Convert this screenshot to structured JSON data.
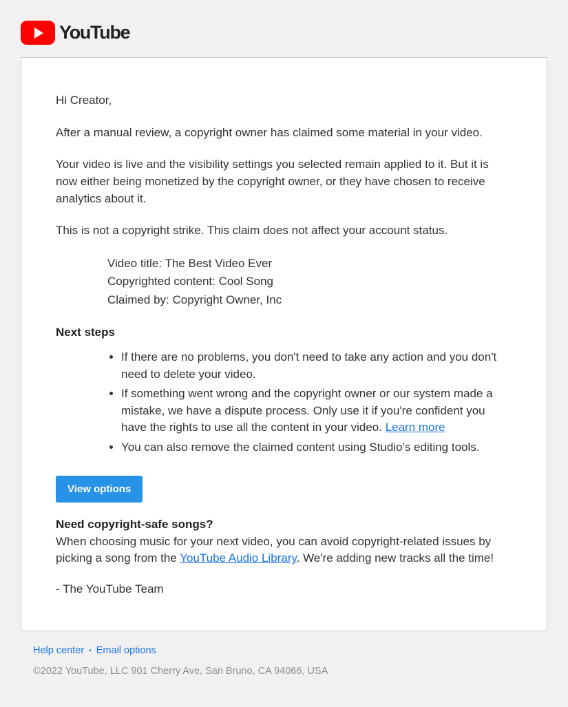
{
  "brand": {
    "wordmark": "YouTube"
  },
  "email": {
    "greeting": "Hi Creator,",
    "p1": "After a manual review, a copyright owner has claimed some material in your video.",
    "p2": "Your video is live and the visibility settings you selected remain applied to it. But it is now either being monetized by the copyright owner, or they have chosen to receive analytics about it.",
    "p3": "This is not a copyright strike. This claim does not affect your account status.",
    "meta": {
      "video_title_label": "Video title: ",
      "video_title_value": "The Best Video Ever",
      "copyrighted_label": "Copyrighted content: ",
      "copyrighted_value": "Cool Song",
      "claimed_by_label": "Claimed by: ",
      "claimed_by_value": "Copyright Owner, Inc"
    },
    "next_steps_heading": "Next steps",
    "next_steps": {
      "0": "If there are no problems, you don't need to take any action and you don't need to delete your video.",
      "1a": "If something went wrong and the copyright owner or our system made a mistake, we have a dispute process. Only use it if you're confident you have the rights to use all the content in your video. ",
      "1_link": "Learn more",
      "2": "You can also remove the claimed content using Studio's editing tools."
    },
    "cta_button": "View options",
    "safe_songs_heading": "Need copyright-safe songs?",
    "safe_songs_body_a": "When choosing music for your next video, you can avoid copyright-related issues by picking a song from the ",
    "safe_songs_link": "YouTube Audio Library",
    "safe_songs_body_b": ". We're adding new tracks all the time!",
    "signoff": "- The YouTube Team"
  },
  "footer": {
    "help_center": "Help center",
    "email_options": "Email options",
    "copyright": "©2022 YouTube, LLC 901 Cherry Ave, San Bruno, CA 94066, USA"
  }
}
